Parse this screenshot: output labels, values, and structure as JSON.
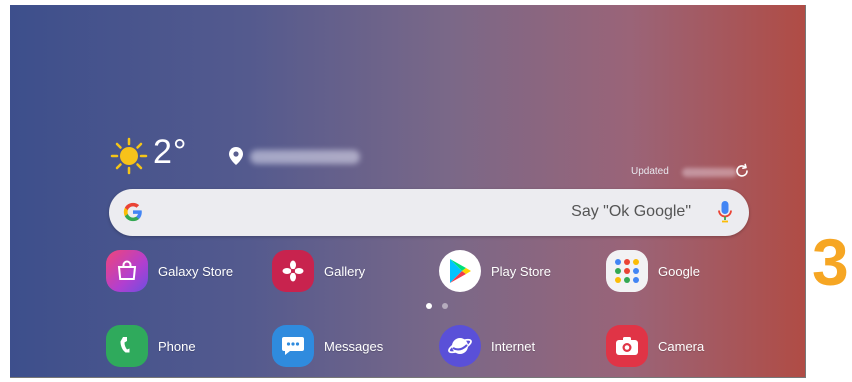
{
  "weather": {
    "temperature": "2°",
    "icon": "sun-icon",
    "updated_label": "Updated"
  },
  "search": {
    "placeholder": "Say \"Ok Google\"",
    "logo_icon": "google-g-icon",
    "mic_icon": "mic-icon"
  },
  "apps_row1": [
    {
      "label": "Galaxy Store",
      "icon": "galaxy-store-icon"
    },
    {
      "label": "Gallery",
      "icon": "gallery-icon"
    },
    {
      "label": "Play Store",
      "icon": "play-store-icon"
    },
    {
      "label": "Google",
      "icon": "google-folder-icon"
    }
  ],
  "apps_row2": [
    {
      "label": "Phone",
      "icon": "phone-icon"
    },
    {
      "label": "Messages",
      "icon": "messages-icon"
    },
    {
      "label": "Internet",
      "icon": "internet-icon"
    },
    {
      "label": "Camera",
      "icon": "camera-icon"
    }
  ],
  "page_indicator": {
    "pages": 2,
    "active": 1
  },
  "callout_number": "3",
  "colors": {
    "gradient_left": "#3d4f8c",
    "gradient_right": "#b04c45",
    "callout": "#f6a623"
  }
}
